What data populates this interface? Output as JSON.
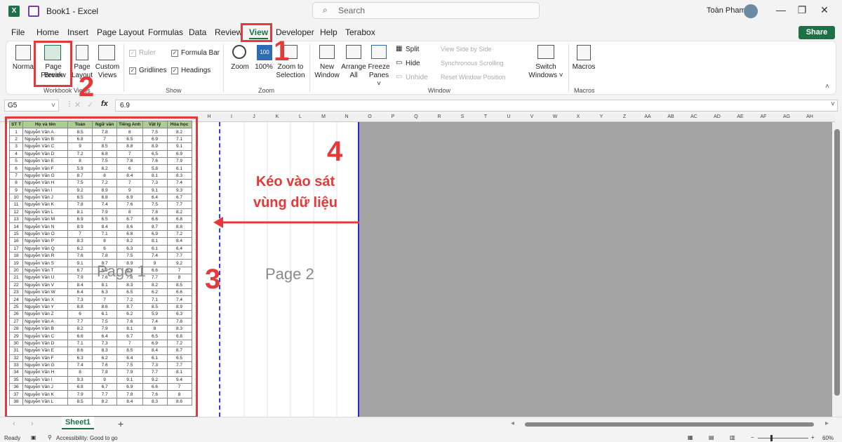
{
  "titlebar": {
    "doc_title": "Book1 - Excel",
    "search_placeholder": "Search",
    "user_name": "Toàn Pham"
  },
  "menu": [
    "File",
    "Home",
    "Insert",
    "Page Layout",
    "Formulas",
    "Data",
    "Review",
    "View",
    "Developer",
    "Help",
    "Terabox"
  ],
  "share_label": "Share",
  "ribbon": {
    "workbook_views": {
      "group": "Workbook Views",
      "normal": "Normal",
      "page_break_1": "Page Break",
      "page_break_2": "Preview",
      "page_layout_1": "Page",
      "page_layout_2": "Layout",
      "custom_1": "Custom",
      "custom_2": "Views"
    },
    "show": {
      "group": "Show",
      "ruler": "Ruler",
      "gridlines": "Gridlines",
      "formula_bar": "Formula Bar",
      "headings": "Headings"
    },
    "zoom": {
      "group": "Zoom",
      "zoom": "Zoom",
      "hundred": "100%",
      "zoom_sel_1": "Zoom to",
      "zoom_sel_2": "Selection"
    },
    "window": {
      "group": "Window",
      "new_1": "New",
      "new_2": "Window",
      "arrange_1": "Arrange",
      "arrange_2": "All",
      "freeze_1": "Freeze",
      "freeze_2": "Panes ˅",
      "split": "Split",
      "hide": "Hide",
      "unhide": "Unhide",
      "side_by_side": "View Side by Side",
      "sync_scroll": "Synchronous Scrolling",
      "reset_pos": "Reset Window Position",
      "switch_1": "Switch",
      "switch_2": "Windows ˅"
    },
    "macros": {
      "group": "Macros",
      "label": "Macros"
    }
  },
  "formula": {
    "name_box": "G5",
    "fx": "fx",
    "value": "6.9"
  },
  "columns": [
    "H",
    "I",
    "J",
    "K",
    "L",
    "M",
    "N",
    "O",
    "P",
    "Q",
    "R",
    "S",
    "T",
    "U",
    "V",
    "W",
    "X",
    "Y",
    "Z",
    "AA",
    "AB",
    "AC",
    "AD",
    "AE",
    "AF",
    "AG",
    "AH"
  ],
  "table": {
    "headers": [
      "ST T",
      "Họ và tên",
      "Toán",
      "Ngữ văn",
      "Tiếng Anh",
      "Vật lý",
      "Hóa học"
    ],
    "rows": [
      [
        "1",
        "Nguyễn Văn A",
        "8.5",
        "7.8",
        "8",
        "7.5",
        "8.2"
      ],
      [
        "2",
        "Nguyễn Văn B",
        "6.8",
        "7",
        "6.5",
        "6.9",
        "7.1"
      ],
      [
        "3",
        "Nguyễn Văn C",
        "9",
        "8.5",
        "8.8",
        "8.9",
        "9.1"
      ],
      [
        "4",
        "Nguyễn Văn D",
        "7.2",
        "6.8",
        "7",
        "6.5",
        "6.9"
      ],
      [
        "5",
        "Nguyễn Văn E",
        "8",
        "7.5",
        "7.8",
        "7.6",
        "7.9"
      ],
      [
        "6",
        "Nguyễn Văn F",
        "5.9",
        "6.2",
        "6",
        "5.8",
        "6.1"
      ],
      [
        "7",
        "Nguyễn Văn G",
        "8.7",
        "8",
        "8.4",
        "8.1",
        "8.3"
      ],
      [
        "8",
        "Nguyễn Văn H",
        "7.5",
        "7.2",
        "7",
        "7.3",
        "7.4"
      ],
      [
        "9",
        "Nguyễn Văn I",
        "9.2",
        "8.9",
        "9",
        "9.1",
        "9.3"
      ],
      [
        "10",
        "Nguyễn Văn J",
        "6.5",
        "6.8",
        "6.9",
        "6.4",
        "6.7"
      ],
      [
        "11",
        "Nguyễn Văn K",
        "7.8",
        "7.4",
        "7.6",
        "7.5",
        "7.7"
      ],
      [
        "12",
        "Nguyễn Văn L",
        "8.1",
        "7.9",
        "8",
        "7.8",
        "8.2"
      ],
      [
        "13",
        "Nguyễn Văn M",
        "6.9",
        "6.5",
        "6.7",
        "6.6",
        "6.8"
      ],
      [
        "14",
        "Nguyễn Văn N",
        "8.9",
        "8.4",
        "8.6",
        "8.7",
        "8.8"
      ],
      [
        "15",
        "Nguyễn Văn O",
        "7",
        "7.1",
        "6.8",
        "6.9",
        "7.2"
      ],
      [
        "16",
        "Nguyễn Văn P",
        "8.3",
        "8",
        "8.2",
        "8.1",
        "8.4"
      ],
      [
        "17",
        "Nguyễn Văn Q",
        "6.2",
        "6",
        "6.3",
        "6.1",
        "6.4"
      ],
      [
        "18",
        "Nguyễn Văn R",
        "7.6",
        "7.8",
        "7.5",
        "7.4",
        "7.7"
      ],
      [
        "19",
        "Nguyễn Văn S",
        "9.1",
        "8.7",
        "8.9",
        "9",
        "9.2"
      ],
      [
        "20",
        "Nguyễn Văn T",
        "6.7",
        "6.9",
        "6.8",
        "6.6",
        "7"
      ],
      [
        "21",
        "Nguyễn Văn U",
        "7.9",
        "7.6",
        "7.8",
        "7.7",
        "8"
      ],
      [
        "22",
        "Nguyễn Văn V",
        "8.4",
        "8.1",
        "8.3",
        "8.2",
        "8.5"
      ],
      [
        "23",
        "Nguyễn Văn W",
        "6.4",
        "6.3",
        "6.5",
        "6.2",
        "6.6"
      ],
      [
        "24",
        "Nguyễn Văn X",
        "7.3",
        "7",
        "7.2",
        "7.1",
        "7.4"
      ],
      [
        "25",
        "Nguyễn Văn Y",
        "8.8",
        "8.6",
        "8.7",
        "8.5",
        "8.9"
      ],
      [
        "26",
        "Nguyễn Văn Z",
        "6",
        "6.1",
        "6.2",
        "5.9",
        "6.3"
      ],
      [
        "27",
        "Nguyễn Văn A",
        "7.7",
        "7.5",
        "7.6",
        "7.4",
        "7.8"
      ],
      [
        "28",
        "Nguyễn Văn B",
        "8.2",
        "7.9",
        "8.1",
        "8",
        "8.3"
      ],
      [
        "29",
        "Nguyễn Văn C",
        "6.6",
        "6.4",
        "6.7",
        "6.5",
        "6.8"
      ],
      [
        "30",
        "Nguyễn Văn D",
        "7.1",
        "7.3",
        "7",
        "6.9",
        "7.2"
      ],
      [
        "31",
        "Nguyễn Văn E",
        "8.6",
        "8.3",
        "8.5",
        "8.4",
        "8.7"
      ],
      [
        "32",
        "Nguyễn Văn F",
        "6.3",
        "6.2",
        "6.4",
        "6.1",
        "6.5"
      ],
      [
        "33",
        "Nguyễn Văn G",
        "7.4",
        "7.6",
        "7.5",
        "7.3",
        "7.7"
      ],
      [
        "34",
        "Nguyễn Văn H",
        "8",
        "7.8",
        "7.9",
        "7.7",
        "8.1"
      ],
      [
        "35",
        "Nguyễn Văn I",
        "9.3",
        "9",
        "9.1",
        "9.2",
        "9.4"
      ],
      [
        "36",
        "Nguyễn Văn J",
        "6.8",
        "6.7",
        "6.9",
        "6.6",
        "7"
      ],
      [
        "37",
        "Nguyễn Văn K",
        "7.9",
        "7.7",
        "7.8",
        "7.6",
        "8"
      ],
      [
        "38",
        "Nguyễn Văn L",
        "8.5",
        "8.2",
        "8.4",
        "8.3",
        "8.6"
      ]
    ]
  },
  "page_labels": {
    "page1": "Page 1",
    "page2": "Page 2"
  },
  "annotations": {
    "n1": "1",
    "n2": "2",
    "n3": "3",
    "n4": "4",
    "note_line1": "Kéo vào sát",
    "note_line2": "vùng dữ liệu",
    "color": "#e63838"
  },
  "sheet_tab": "Sheet1",
  "add_sheet": "+",
  "status": {
    "ready": "Ready",
    "accessibility": "Accessibility: Good to go",
    "zoom": "60%"
  }
}
